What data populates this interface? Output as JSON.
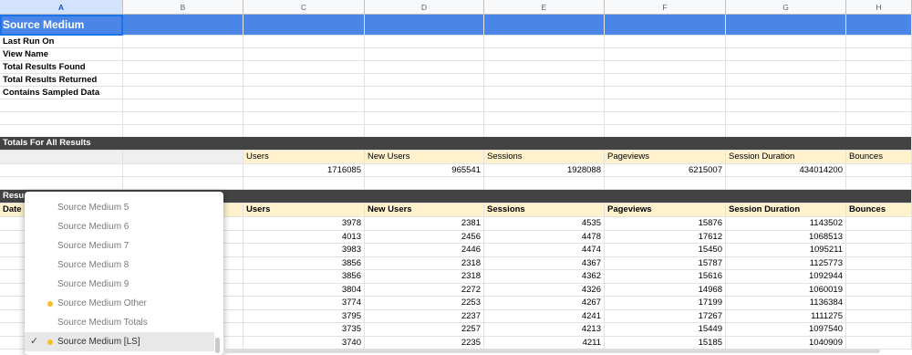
{
  "columns": [
    "A",
    "B",
    "C",
    "D",
    "E",
    "F",
    "G",
    "H"
  ],
  "title": "Source Medium",
  "info_labels": [
    "Last Run On",
    "View Name",
    "Total Results Found",
    "Total Results Returned",
    "Contains Sampled Data"
  ],
  "totals": {
    "header": "Totals For All Results",
    "metrics": [
      "Users",
      "New Users",
      "Sessions",
      "Pageviews",
      "Session Duration",
      "Bounces"
    ],
    "values": [
      "1716085",
      "965541",
      "1928088",
      "6215007",
      "434014200",
      ""
    ]
  },
  "results": {
    "header": "Resu",
    "columns": [
      "Date",
      "",
      "Users",
      "New Users",
      "Sessions",
      "Pageviews",
      "Session Duration",
      "Bounces"
    ],
    "rows": [
      [
        "3978",
        "2381",
        "4535",
        "15876",
        "1143502"
      ],
      [
        "4013",
        "2456",
        "4478",
        "17612",
        "1068513"
      ],
      [
        "3983",
        "2446",
        "4474",
        "15450",
        "1095211"
      ],
      [
        "3856",
        "2318",
        "4367",
        "15787",
        "1125773"
      ],
      [
        "3856",
        "2318",
        "4362",
        "15616",
        "1092944"
      ],
      [
        "3804",
        "2272",
        "4326",
        "14968",
        "1060019"
      ],
      [
        "3774",
        "2253",
        "4267",
        "17199",
        "1136384"
      ],
      [
        "3795",
        "2237",
        "4241",
        "17267",
        "1111275"
      ],
      [
        "3735",
        "2257",
        "4213",
        "15449",
        "1097540"
      ],
      [
        "3740",
        "2235",
        "4211",
        "15185",
        "1040909"
      ]
    ]
  },
  "dropdown": {
    "items": [
      {
        "label": "Source Medium 5",
        "dot": false,
        "checked": false
      },
      {
        "label": "Source Medium 6",
        "dot": false,
        "checked": false
      },
      {
        "label": "Source Medium 7",
        "dot": false,
        "checked": false
      },
      {
        "label": "Source Medium 8",
        "dot": false,
        "checked": false
      },
      {
        "label": "Source Medium 9",
        "dot": false,
        "checked": false
      },
      {
        "label": "Source Medium Other",
        "dot": true,
        "checked": false
      },
      {
        "label": "Source Medium Totals",
        "dot": false,
        "checked": false
      },
      {
        "label": "Source Medium [LS]",
        "dot": true,
        "checked": true
      }
    ],
    "check_glyph": "✓"
  },
  "colors": {
    "title_bar": "#4a86e8",
    "section_bar": "#434343",
    "metric_bg": "#fff2cc",
    "dot": "#f6bf26"
  }
}
